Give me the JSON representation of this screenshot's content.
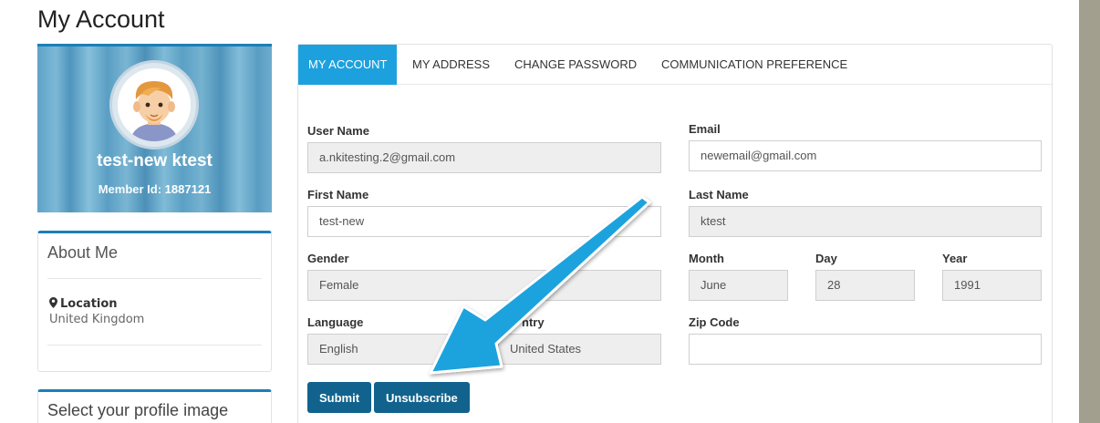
{
  "page": {
    "title": "My Account"
  },
  "profile": {
    "name": "test-new ktest",
    "member_id_label": "Member Id:",
    "member_id": "1887121"
  },
  "about": {
    "title": "About Me",
    "location_label": "Location",
    "location_value": "United Kingdom"
  },
  "select_image": {
    "title": "Select your profile image"
  },
  "tabs": [
    {
      "label": "MY ACCOUNT",
      "active": true
    },
    {
      "label": "MY ADDRESS",
      "active": false
    },
    {
      "label": "CHANGE PASSWORD",
      "active": false
    },
    {
      "label": "COMMUNICATION PREFERENCE",
      "active": false
    }
  ],
  "form": {
    "username": {
      "label": "User Name",
      "value": "a.nkitesting.2@gmail.com"
    },
    "email": {
      "label": "Email",
      "value": "newemail@gmail.com"
    },
    "first_name": {
      "label": "First Name",
      "value": "test-new"
    },
    "last_name": {
      "label": "Last Name",
      "value": "ktest"
    },
    "gender": {
      "label": "Gender",
      "value": "Female"
    },
    "month": {
      "label": "Month",
      "value": "June"
    },
    "day": {
      "label": "Day",
      "value": "28"
    },
    "year": {
      "label": "Year",
      "value": "1991"
    },
    "language": {
      "label": "Language",
      "value": "English"
    },
    "country": {
      "label": "ntry",
      "value": "United States"
    },
    "zip": {
      "label": "Zip Code",
      "value": ""
    }
  },
  "buttons": {
    "submit": "Submit",
    "unsubscribe": "Unsubscribe"
  },
  "colors": {
    "accent": "#1da1de",
    "button": "#11638d",
    "arrow": "#1fa3de",
    "side_bg": "#a39f8f"
  },
  "icons": {
    "location": "map-marker-icon",
    "avatar": "user-avatar",
    "annotation": "arrow-annotation"
  }
}
